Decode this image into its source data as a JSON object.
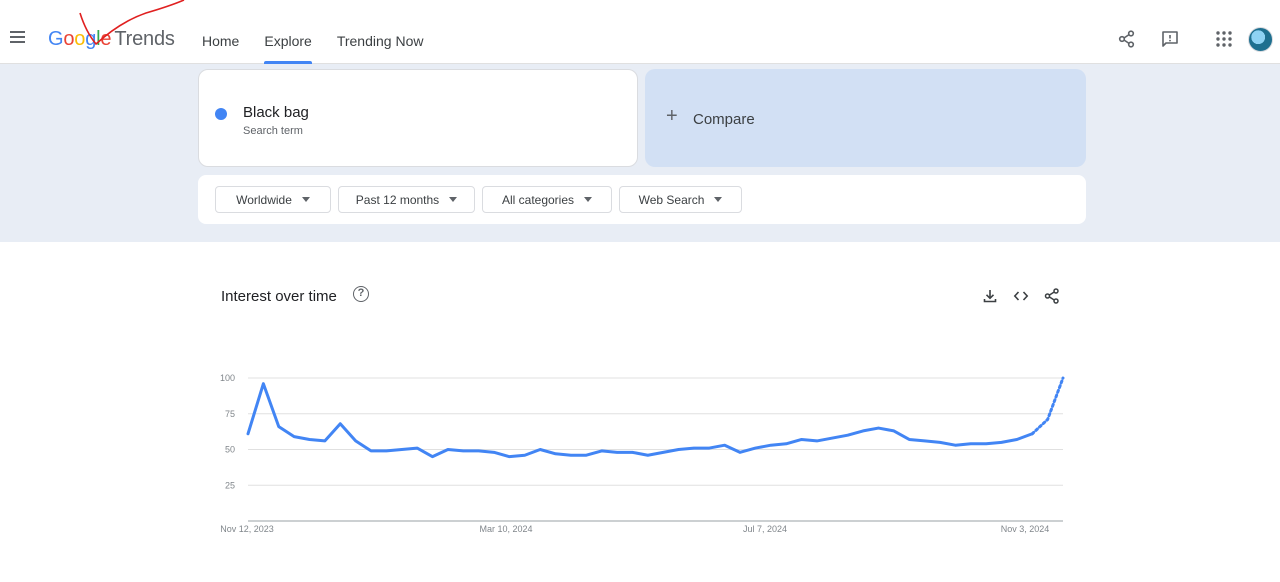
{
  "header": {
    "logo_google": [
      "G",
      "o",
      "o",
      "g",
      "l",
      "e"
    ],
    "logo_product": "Trends",
    "nav": [
      "Home",
      "Explore",
      "Trending Now"
    ],
    "active_nav": "Explore",
    "icons": [
      "share-icon",
      "feedback-icon",
      "apps-icon",
      "avatar"
    ]
  },
  "search": {
    "term": "Black bag",
    "term_type": "Search term",
    "term_color": "#4285f4",
    "compare_label": "Compare"
  },
  "filters": {
    "region": "Worldwide",
    "time_range": "Past 12 months",
    "category": "All categories",
    "search_type": "Web Search"
  },
  "interest_card": {
    "title": "Interest over time",
    "icons": [
      "download-icon",
      "embed-icon",
      "share-icon"
    ]
  },
  "chart_data": {
    "type": "line",
    "title": "Interest over time",
    "y_ticks": [
      "100",
      "75",
      "50",
      "25"
    ],
    "ylim": [
      0,
      100
    ],
    "grid": true,
    "x_ticks": [
      "Nov 12, 2023",
      "Mar 10, 2024",
      "Jul 7, 2024",
      "Nov 3, 2024"
    ],
    "series": [
      {
        "name": "Black bag",
        "color": "#4285f4",
        "values": [
          61,
          96,
          66,
          59,
          57,
          56,
          68,
          56,
          49,
          49,
          50,
          51,
          45,
          50,
          49,
          49,
          48,
          45,
          46,
          50,
          47,
          46,
          46,
          49,
          48,
          48,
          46,
          48,
          50,
          51,
          51,
          53,
          48,
          51,
          53,
          54,
          57,
          56,
          58,
          60,
          63,
          65,
          63,
          57,
          56,
          55,
          53,
          54,
          54,
          55,
          57,
          61,
          71,
          100
        ],
        "partial_last": 2
      }
    ]
  }
}
